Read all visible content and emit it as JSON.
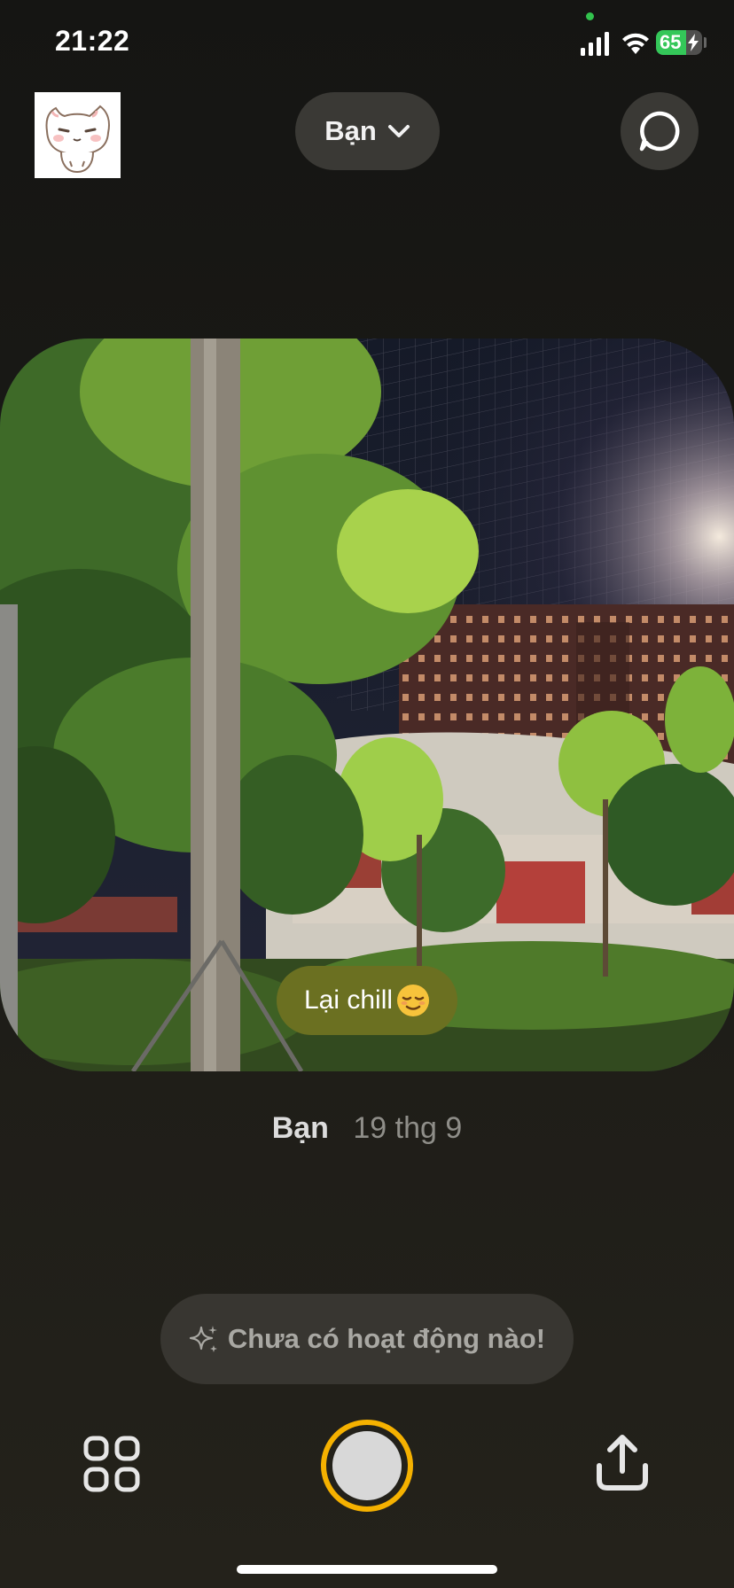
{
  "status_bar": {
    "time": "21:22",
    "battery_level": "65",
    "battery_fraction": 0.65,
    "icons": [
      "signal-icon",
      "wifi-icon",
      "battery-icon",
      "charging-bolt-icon"
    ]
  },
  "header": {
    "friend_selector_label": "Bạn",
    "icons": [
      "chevron-down-icon",
      "chat-bubble-icon"
    ]
  },
  "photo": {
    "caption": "Lại chill",
    "caption_emoji": "relieved-face-emoji"
  },
  "meta": {
    "author": "Bạn",
    "date": "19 thg 9"
  },
  "activity": {
    "text": "Chưa có hoạt động nào!",
    "icon": "sparkle-icon"
  },
  "bottom_bar": {
    "icons": [
      "grid-icon",
      "shutter-button",
      "share-icon"
    ]
  },
  "colors": {
    "accent": "#f5b100",
    "caption_bg": "#6b7021",
    "pill_bg": "#3a3935"
  }
}
